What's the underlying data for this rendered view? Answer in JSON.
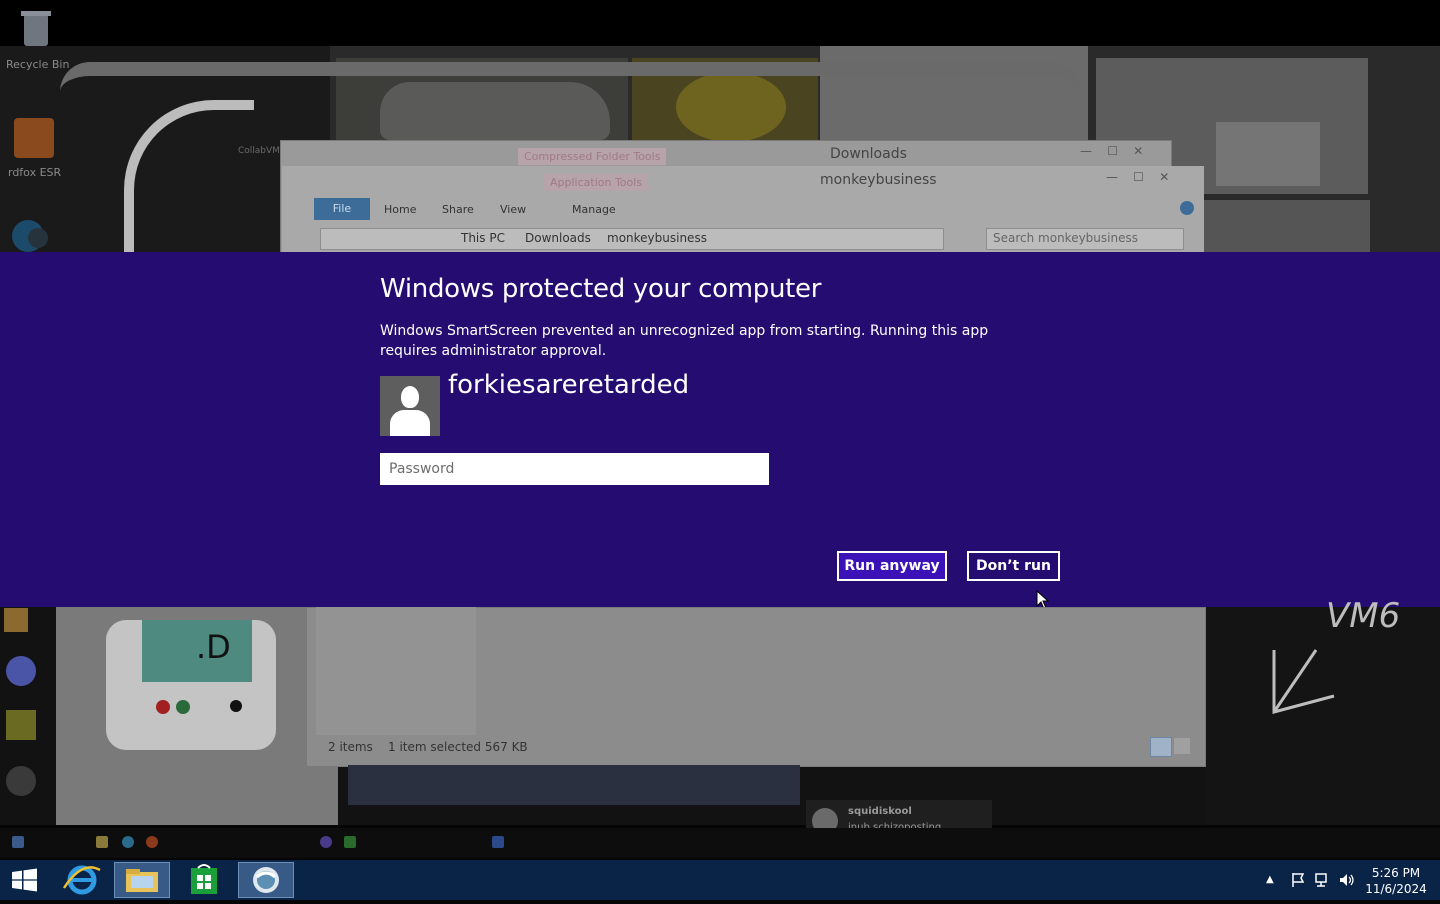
{
  "desktop": {
    "icons": [
      {
        "label": "Recycle Bin"
      },
      {
        "label": "rdfox ESR"
      }
    ]
  },
  "explorer": {
    "back_title": "Downloads",
    "back_context_tab": "Compressed Folder Tools",
    "front_title": "monkeybusiness",
    "front_context_tab": "Application Tools",
    "tabs": {
      "file": "File",
      "home": "Home",
      "share": "Share",
      "view": "View",
      "manage": "Manage"
    },
    "breadcrumb": [
      "This PC",
      "Downloads",
      "monkeybusiness"
    ],
    "search_placeholder": "Search monkeybusiness",
    "status_items": "2 items",
    "status_selected": "1 item selected  567 KB"
  },
  "smartscreen": {
    "title": "Windows protected your computer",
    "message": "Windows SmartScreen prevented an unrecognized app from starting. Running this app requires administrator approval.",
    "username": "forkiesareretarded",
    "password_placeholder": "Password",
    "run_label": "Run anyway",
    "dont_run_label": "Don’t run",
    "colors": {
      "band": "#240c70",
      "run_button": "#3b12b8"
    }
  },
  "background_misc": {
    "vm_text": "VM6",
    "notif_user": "squidiskool",
    "notif_msg": "inub schizoposting",
    "robot_face": ".D"
  },
  "taskbar": {
    "apps": [
      "windows-start-icon",
      "internet-explorer-icon",
      "file-explorer-icon",
      "store-icon",
      "orb-app-icon"
    ],
    "time": "5:26 PM",
    "date": "11/6/2024"
  }
}
